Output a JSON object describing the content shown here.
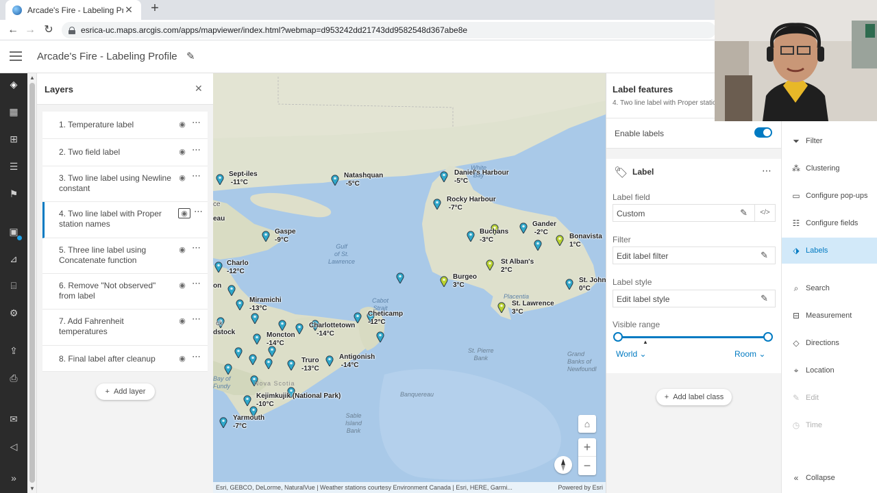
{
  "browser": {
    "tab_title": "Arcade's Fire - Labeling Profile",
    "url": "esrica-uc.maps.arcgis.com/apps/mapviewer/index.html?webmap=d953242dd21743dd9582548d367abe8e"
  },
  "app": {
    "title": "Arcade's Fire - Labeling Profile"
  },
  "layers_panel": {
    "title": "Layers",
    "add_layer_label": "Add layer",
    "items": [
      {
        "label": "1. Temperature label"
      },
      {
        "label": "2. Two field label"
      },
      {
        "label": "3. Two line label using Newline constant"
      },
      {
        "label": "4. Two line label with Proper station names",
        "selected": true
      },
      {
        "label": "5. Three line label using Concatenate function"
      },
      {
        "label": "6. Remove \"Not observed\" from label"
      },
      {
        "label": "7. Add Fahrenheit temperatures"
      },
      {
        "label": "8. Final label after cleanup"
      }
    ]
  },
  "map": {
    "stations": [
      {
        "name": "Sept-iles",
        "temp": "-11°C"
      },
      {
        "name": "Natashquan",
        "temp": "-5°C"
      },
      {
        "name": "Daniel's Harbour",
        "temp": "-5°C"
      },
      {
        "name": "Rocky Harbour",
        "temp": "-7°C"
      },
      {
        "name": "Gander",
        "temp": "-2°C"
      },
      {
        "name": "Buchans",
        "temp": "-3°C"
      },
      {
        "name": "Bonavista",
        "temp": "1°C"
      },
      {
        "name": "Gaspe",
        "temp": "-9°C"
      },
      {
        "name": "St Alban's",
        "temp": "2°C"
      },
      {
        "name": "Charlo",
        "temp": "-12°C"
      },
      {
        "name": "Burgeo",
        "temp": "3°C"
      },
      {
        "name": "St. John",
        "temp": "0°C"
      },
      {
        "name": "Miramichi",
        "temp": "-13°C"
      },
      {
        "name": "St. Lawrence",
        "temp": "3°C"
      },
      {
        "name": "Cheticamp",
        "temp": "-12°C"
      },
      {
        "name": "Charlottetown",
        "temp": "-14°C"
      },
      {
        "name": "Moncton",
        "temp": "-14°C"
      },
      {
        "name": "Antigonish",
        "temp": "-14°C"
      },
      {
        "name": "Truro",
        "temp": "-13°C"
      },
      {
        "name": "Kejimkujik (National Park)",
        "temp": "-10°C"
      },
      {
        "name": "Yarmouth",
        "temp": "-7°C"
      }
    ],
    "water_labels": {
      "gulf": "Gulf\nof St.\nLawrence",
      "white_bay": "White\nBay",
      "cabot": "Cabot\nStrait",
      "placentia": "Placentia",
      "bay_fundy": "Bay of\nFundy",
      "st_pierre_bank": "St. Pierre\nBank",
      "grand_banks": "Grand\nBanks of\nNewfoundl",
      "banquereau": "Banquereau",
      "sable": "Sable\nIsland\nBank"
    },
    "land_labels": {
      "nova_scotia": "Nova Scotia",
      "edge_1": "ce",
      "edge_2": "eau",
      "edge_3": "on",
      "edge_4": "ck",
      "edge_5": "dstock"
    },
    "attribution": "Esri, GEBCO, DeLorme, NaturalVue | Weather stations courtesy Environment Canada | Esri, HERE, Garmi...",
    "powered_by": "Powered by Esri"
  },
  "label_panel": {
    "title": "Label features",
    "subtitle": "4. Two line label with Proper station names",
    "enable_labels_label": "Enable labels",
    "enable_labels": true,
    "card_title": "Label",
    "label_field_heading": "Label field",
    "label_field_value": "Custom",
    "filter_heading": "Filter",
    "filter_value": "Edit label filter",
    "style_heading": "Label style",
    "style_value": "Edit label style",
    "visible_range_heading": "Visible range",
    "range_min": "World",
    "range_max": "Room",
    "add_label_class": "Add label class"
  },
  "tools": [
    {
      "label": "Filter",
      "icon": "filter-icon"
    },
    {
      "label": "Clustering",
      "icon": "clustering-icon"
    },
    {
      "label": "Configure pop-ups",
      "icon": "popup-icon"
    },
    {
      "label": "Configure fields",
      "icon": "fields-icon"
    },
    {
      "label": "Labels",
      "icon": "labels-icon",
      "active": true
    },
    {
      "label": "Search",
      "icon": "search-icon"
    },
    {
      "label": "Measurement",
      "icon": "measurement-icon"
    },
    {
      "label": "Directions",
      "icon": "directions-icon"
    },
    {
      "label": "Location",
      "icon": "location-icon"
    },
    {
      "label": "Edit",
      "icon": "edit-icon",
      "disabled": true
    },
    {
      "label": "Time",
      "icon": "time-icon",
      "disabled": true
    },
    {
      "label": "Collapse",
      "icon": "collapse-icon"
    }
  ],
  "colors": {
    "accent": "#007ac2",
    "pin_blue": "#2fa7c9",
    "pin_green": "#b9d12f",
    "water": "#a9c9e8",
    "land": "#e6e3d6"
  }
}
